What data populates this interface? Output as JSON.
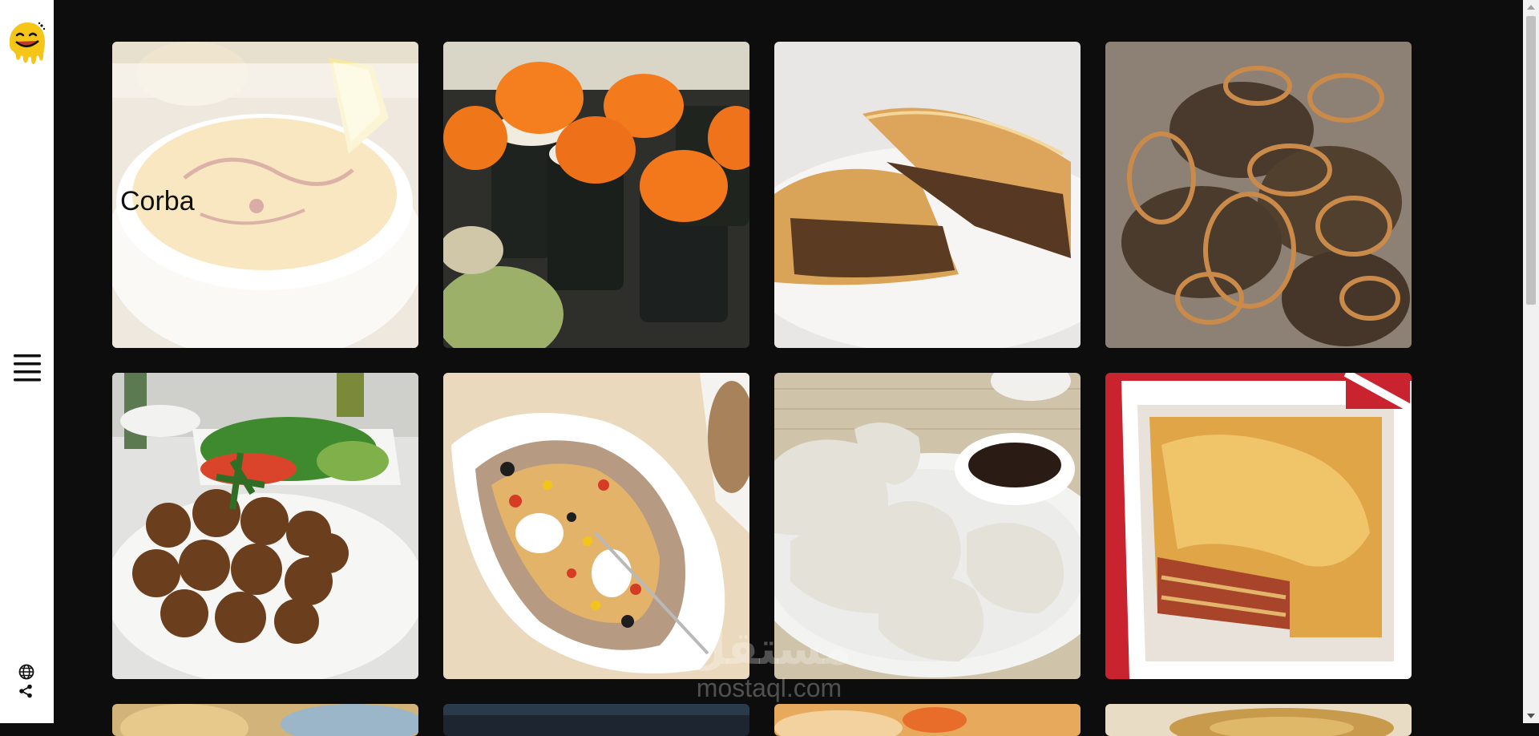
{
  "sidebar": {
    "logo_icon": "smiley-drip-logo",
    "menu_icon": "hamburger-menu-icon",
    "language_icon": "globe-icon",
    "share_icon": "share-icon"
  },
  "cards": [
    {
      "title": "Corba",
      "image": "lentil-soup-photo"
    },
    {
      "title": "",
      "image": "sushi-roe-rolls-photo"
    },
    {
      "title": "",
      "image": "meat-burek-pie-photo"
    },
    {
      "title": "",
      "image": "liver-onions-photo"
    },
    {
      "title": "",
      "image": "falafel-plate-photo"
    },
    {
      "title": "",
      "image": "kumpir-baked-potato-photo"
    },
    {
      "title": "",
      "image": "dumplings-soy-sauce-photo"
    },
    {
      "title": "",
      "image": "lasagna-dish-photo"
    }
  ],
  "watermark": {
    "arabic": "مستقل",
    "latin": "mostaql.com"
  },
  "colors": {
    "background": "#0d0d0d",
    "sidebar": "#ffffff",
    "logo": "#f5c518"
  }
}
